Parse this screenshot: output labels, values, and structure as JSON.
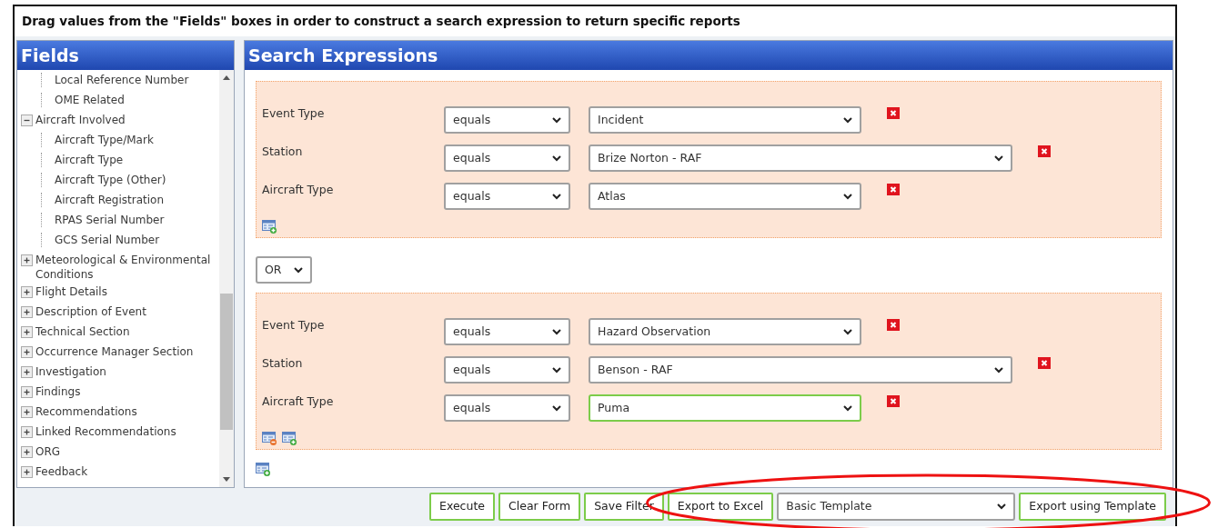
{
  "instruction": "Drag values from the \"Fields\" boxes in order to construct a search expression to return specific reports",
  "fields_panel": {
    "title": "Fields",
    "tree": [
      {
        "children": [
          {
            "label": "Local Reference Number"
          },
          {
            "label": "OME Related"
          }
        ]
      },
      {
        "label": "Aircraft Involved",
        "expanded": true,
        "children": [
          {
            "label": "Aircraft Type/Mark"
          },
          {
            "label": "Aircraft Type"
          },
          {
            "label": "Aircraft Type (Other)"
          },
          {
            "label": "Aircraft Registration"
          },
          {
            "label": "RPAS Serial Number"
          },
          {
            "label": "GCS Serial Number"
          }
        ]
      },
      {
        "label": "Meteorological & Environmental Conditions",
        "expanded": false
      },
      {
        "label": "Flight Details",
        "expanded": false
      },
      {
        "label": "Description of Event",
        "expanded": false
      },
      {
        "label": "Technical Section",
        "expanded": false
      },
      {
        "label": "Occurrence Manager Section",
        "expanded": false
      },
      {
        "label": "Investigation",
        "expanded": false
      },
      {
        "label": "Findings",
        "expanded": false
      },
      {
        "label": "Recommendations",
        "expanded": false
      },
      {
        "label": "Linked Recommendations",
        "expanded": false
      },
      {
        "label": "ORG",
        "expanded": false
      },
      {
        "label": "Feedback",
        "expanded": false
      }
    ]
  },
  "search_panel": {
    "title": "Search Expressions",
    "groups": [
      {
        "can_remove": false,
        "rows": [
          {
            "field": "Event Type",
            "operator": "equals",
            "value": "Incident",
            "kind": "short",
            "focused": false
          },
          {
            "field": "Station",
            "operator": "equals",
            "value": "Brize Norton - RAF",
            "kind": "long",
            "focused": false
          },
          {
            "field": "Aircraft Type",
            "operator": "equals",
            "value": "Atlas",
            "kind": "short",
            "focused": false
          }
        ]
      },
      {
        "connector": "OR",
        "can_remove": true,
        "rows": [
          {
            "field": "Event Type",
            "operator": "equals",
            "value": "Hazard Observation",
            "kind": "short",
            "focused": false
          },
          {
            "field": "Station",
            "operator": "equals",
            "value": "Benson - RAF",
            "kind": "long",
            "focused": false
          },
          {
            "field": "Aircraft Type",
            "operator": "equals",
            "value": "Puma",
            "kind": "short",
            "focused": true
          }
        ]
      }
    ]
  },
  "actions": {
    "buttons": [
      "Execute",
      "Clear Form",
      "Save Filter",
      "Export to Excel"
    ],
    "template": "Basic Template",
    "template_button": "Export using Template"
  },
  "annotation": {
    "kind": "ellipse"
  }
}
